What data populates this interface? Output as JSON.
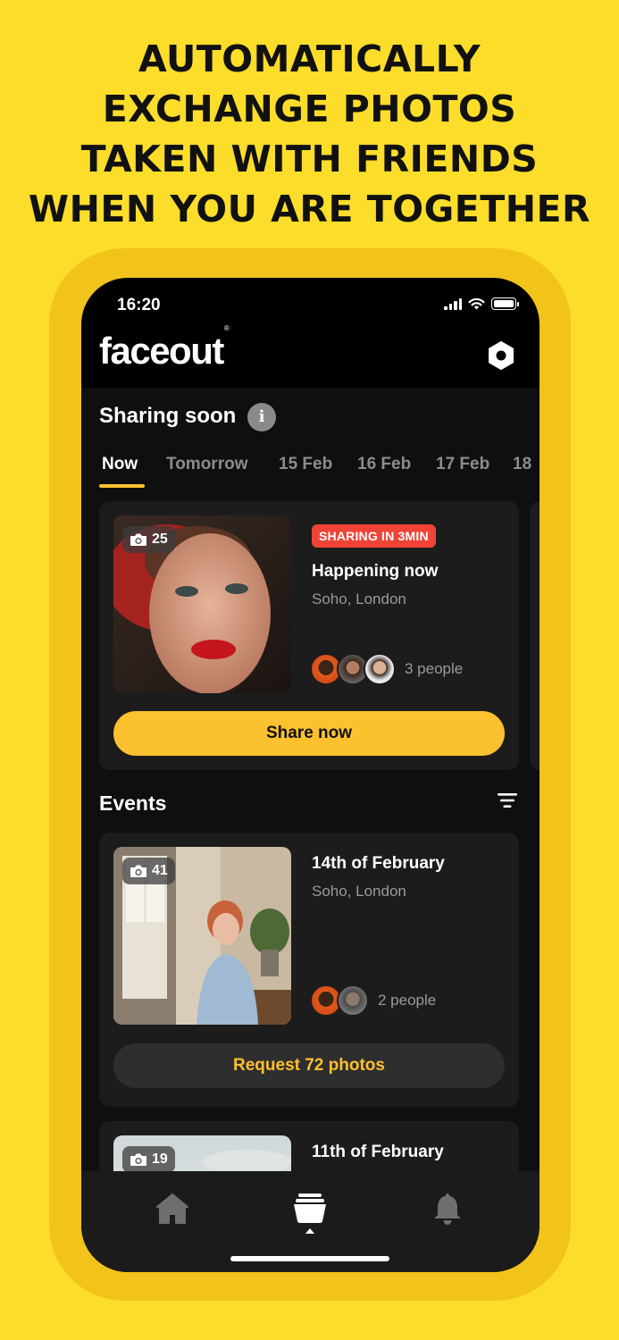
{
  "headline": {
    "line1": "AUTOMATICALLY",
    "line2": "EXCHANGE PHOTOS",
    "line3": "TAKEN WITH FRIENDS",
    "line4": "WHEN YOU ARE TOGETHER"
  },
  "status_bar": {
    "time": "16:20"
  },
  "app": {
    "logo": "faceout",
    "logo_mark": "®"
  },
  "sharing_soon": {
    "title": "Sharing soon",
    "info_icon_glyph": "i",
    "tabs": [
      {
        "label": "Now",
        "active": true
      },
      {
        "label": "Tomorrow",
        "active": false
      },
      {
        "label": "15 Feb",
        "active": false
      },
      {
        "label": "16 Feb",
        "active": false
      },
      {
        "label": "17 Feb",
        "active": false
      },
      {
        "label": "18",
        "active": false
      }
    ],
    "card": {
      "photo_count": "25",
      "badge": "SHARING IN 3MIN",
      "title": "Happening now",
      "location": "Soho, London",
      "people": "3 people",
      "button": "Share now"
    }
  },
  "events": {
    "title": "Events",
    "items": [
      {
        "photo_count": "41",
        "title": "14th of February",
        "location": "Soho, London",
        "people": "2 people",
        "button": "Request 72 photos"
      },
      {
        "photo_count": "19",
        "title": "11th of February"
      }
    ]
  },
  "tabbar": {
    "items": [
      {
        "icon": "home-icon",
        "active": false
      },
      {
        "icon": "events-stack-icon",
        "active": true
      },
      {
        "icon": "bell-icon",
        "active": false
      }
    ]
  },
  "colors": {
    "background": "#FCDD2A",
    "frame": "#F2C31A",
    "accent": "#FCC12E",
    "badge_red": "#EF4336",
    "card": "#1c1c1c"
  }
}
